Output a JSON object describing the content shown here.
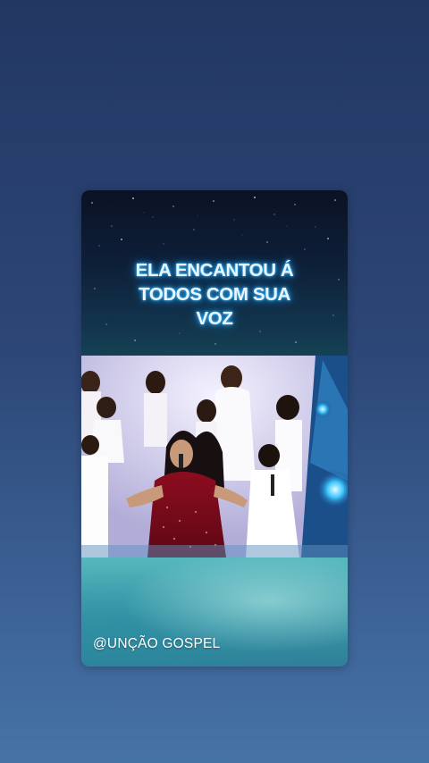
{
  "card": {
    "caption": "ELA ENCANTOU Á\nTODOS COM SUA\nVOZ",
    "handle": "@UNÇÃO GOSPEL"
  },
  "video": {
    "subject": "children's choir singing on stage, lead girl in red sequined dress"
  },
  "colors": {
    "page_top": "#233763",
    "page_bottom": "#4673a6",
    "caption_glow": "#2bb0ff",
    "footer_teal": "#3a97a8"
  }
}
